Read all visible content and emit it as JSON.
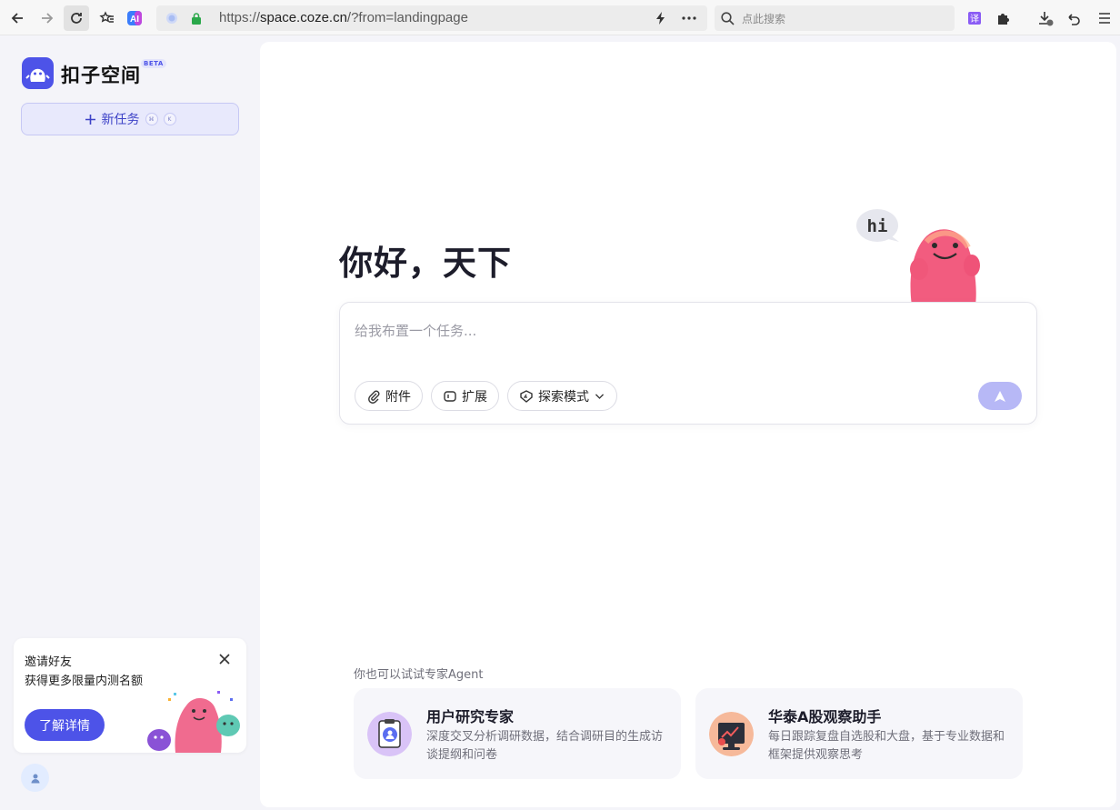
{
  "browser": {
    "url_scheme": "https://",
    "url_host": "space.coze.cn",
    "url_path": "/?from=landingpage",
    "search_placeholder": "点此搜索"
  },
  "sidebar": {
    "logo_text": "扣子空间",
    "beta": "BETA",
    "new_task_label": "新任务",
    "shortcut_cmd": "⌘",
    "shortcut_key": "K"
  },
  "invite": {
    "title": "邀请好友",
    "subtitle": "获得更多限量内测名额",
    "button": "了解详情"
  },
  "main": {
    "greeting": "你好，天下",
    "input_placeholder": "给我布置一个任务...",
    "chips": {
      "attach": "附件",
      "extend": "扩展",
      "mode": "探索模式"
    },
    "mascot_bubble": "hi",
    "agents_title": "你也可以试试专家Agent",
    "agents": [
      {
        "name": "用户研究专家",
        "desc": "深度交叉分析调研数据，结合调研目的生成访谈提纲和问卷"
      },
      {
        "name": "华泰A股观察助手",
        "desc": "每日跟踪复盘自选股和大盘，基于专业数据和框架提供观察思考"
      }
    ]
  },
  "colors": {
    "brand": "#4d53e8",
    "send_disabled": "#b7b8f6",
    "mascot_pink": "#f25c7f"
  }
}
